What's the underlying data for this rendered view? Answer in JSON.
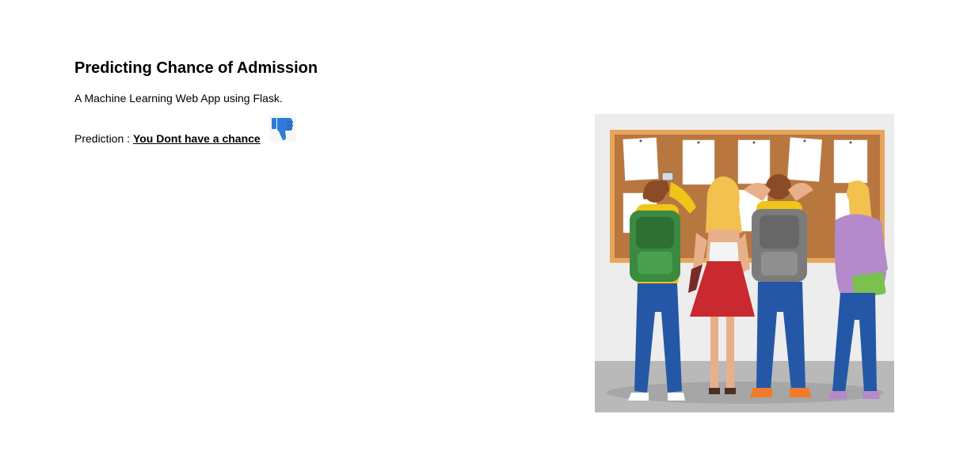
{
  "header": {
    "title": "Predicting Chance of Admission",
    "subtitle": "A Machine Learning Web App using Flask."
  },
  "prediction": {
    "label": "Prediction : ",
    "result": "You Dont have a chance",
    "icon": "thumbs-down-icon"
  },
  "illustration": {
    "subject": "students-at-notice-board"
  },
  "colors": {
    "icon_blue": "#2f7bd8",
    "board_frame": "#e8a65a",
    "cork": "#b8773f"
  }
}
